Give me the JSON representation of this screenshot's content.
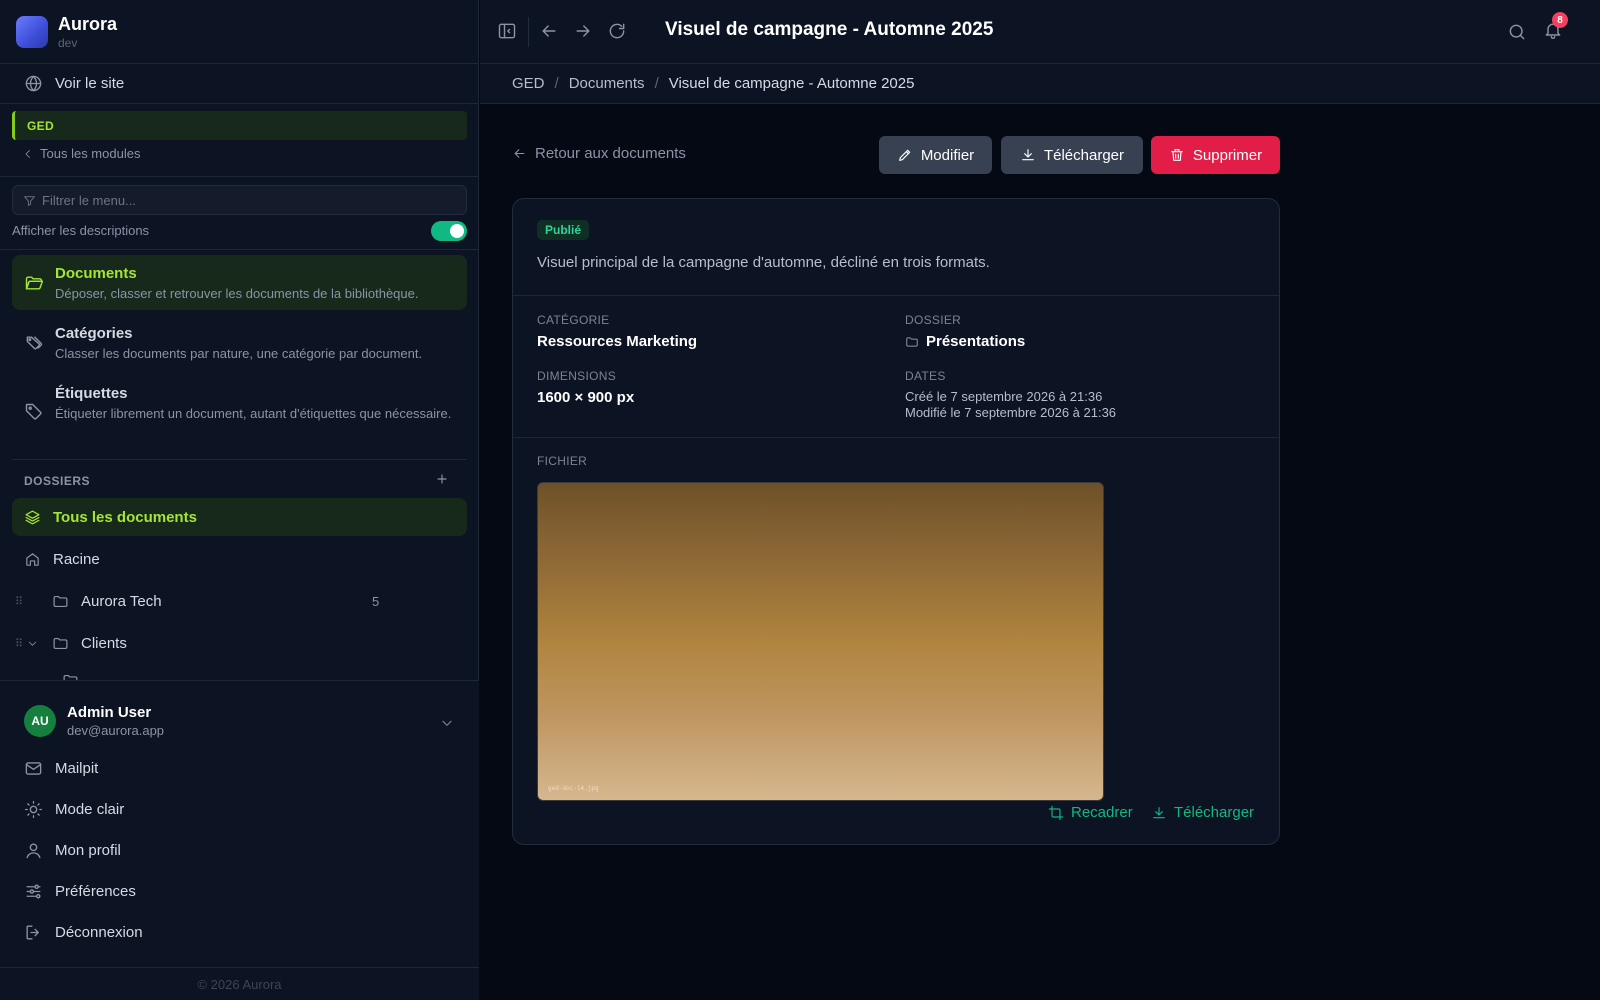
{
  "brand": {
    "name": "Aurora",
    "env": "dev"
  },
  "sidebar": {
    "view_site": "Voir le site",
    "module": "GED",
    "all_modules": "Tous les modules",
    "filter_placeholder": "Filtrer le menu...",
    "show_descriptions": "Afficher les descriptions",
    "show_descriptions_on": true,
    "nav": [
      {
        "title": "Documents",
        "desc": "Déposer, classer et retrouver les documents de la bibliothèque.",
        "icon": "folder-open-icon",
        "active": true
      },
      {
        "title": "Catégories",
        "desc": "Classer les documents par nature, une catégorie par document.",
        "icon": "tags-icon",
        "active": false
      },
      {
        "title": "Étiquettes",
        "desc": "Étiqueter librement un document, autant d'étiquettes que nécessaire.",
        "icon": "tag-icon",
        "active": false
      }
    ],
    "folders_heading": "DOSSIERS",
    "folders": [
      {
        "label": "Tous les documents",
        "icon": "layers-icon",
        "active": true
      },
      {
        "label": "Racine",
        "icon": "home-icon"
      },
      {
        "label": "Aurora Tech",
        "icon": "folder-icon",
        "count": "5"
      },
      {
        "label": "Clients",
        "icon": "folder-icon",
        "expanded": true
      }
    ]
  },
  "user": {
    "initials": "AU",
    "name": "Admin User",
    "email": "dev@aurora.app",
    "menu": [
      {
        "label": "Mailpit",
        "icon": "mail-icon"
      },
      {
        "label": "Mode clair",
        "icon": "sun-icon"
      },
      {
        "label": "Mon profil",
        "icon": "user-icon"
      },
      {
        "label": "Préférences",
        "icon": "sliders-icon"
      },
      {
        "label": "Déconnexion",
        "icon": "logout-icon"
      }
    ],
    "copyright": "© 2026 Aurora"
  },
  "topbar": {
    "title": "Visuel de campagne - Automne 2025",
    "notifications": "8"
  },
  "breadcrumb": [
    "GED",
    "Documents",
    "Visuel de campagne - Automne 2025"
  ],
  "actions": {
    "back": "Retour aux documents",
    "edit": "Modifier",
    "download": "Télécharger",
    "delete": "Supprimer"
  },
  "document": {
    "status": "Publié",
    "description": "Visuel principal de la campagne d'automne, décliné en trois formats.",
    "category_label": "CATÉGORIE",
    "category": "Ressources Marketing",
    "folder_label": "DOSSIER",
    "folder": "Présentations",
    "dimensions_label": "DIMENSIONS",
    "dimensions": "1600 × 900 px",
    "dates_label": "DATES",
    "created": "Créé le 7 septembre 2026 à 21:36",
    "modified": "Modifié le 7 septembre 2026 à 21:36",
    "file_label": "FICHIER",
    "file_name": "ged-doc-14.jpg",
    "crop": "Recadrer",
    "download": "Télécharger"
  },
  "colors": {
    "accent": "#a3e635",
    "success": "#10b981",
    "danger": "#e11d48",
    "badge": "#f43f5e"
  }
}
